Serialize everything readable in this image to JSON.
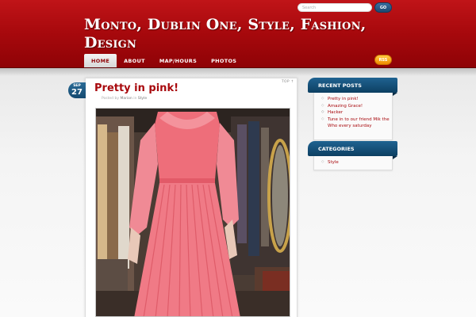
{
  "header": {
    "site_title": "Monto, Dublin One, Style, Fashion, Design",
    "search_placeholder": "Search",
    "go_label": "GO",
    "rss_label": "RSS",
    "nav": [
      {
        "label": "HOME",
        "active": true
      },
      {
        "label": "ABOUT",
        "active": false
      },
      {
        "label": "MAP/HOURS",
        "active": false
      },
      {
        "label": "PHOTOS",
        "active": false
      }
    ]
  },
  "post": {
    "date_month": "SEP",
    "date_day": "27",
    "top_label": "TOP ↑",
    "title": "Pretty in pink!",
    "meta_prefix": "Posted by",
    "author": "Marion",
    "meta_in": "in",
    "category": "Style",
    "image_description": "photo of pink pleated dress on mannequin"
  },
  "sidebar": {
    "recent_posts": {
      "title": "RECENT POSTS",
      "items": [
        "Pretty in pink!",
        "Amazing Grace!",
        "",
        "Hacker",
        "Tune in to our friend Mik the Who every saturday"
      ]
    },
    "categories": {
      "title": "CATEGORIES",
      "items": [
        "Style"
      ]
    }
  },
  "colors": {
    "header_red": "#a8090d",
    "link_red": "#a8090d",
    "widget_blue": "#1a5884",
    "rss_orange": "#f08a00"
  }
}
